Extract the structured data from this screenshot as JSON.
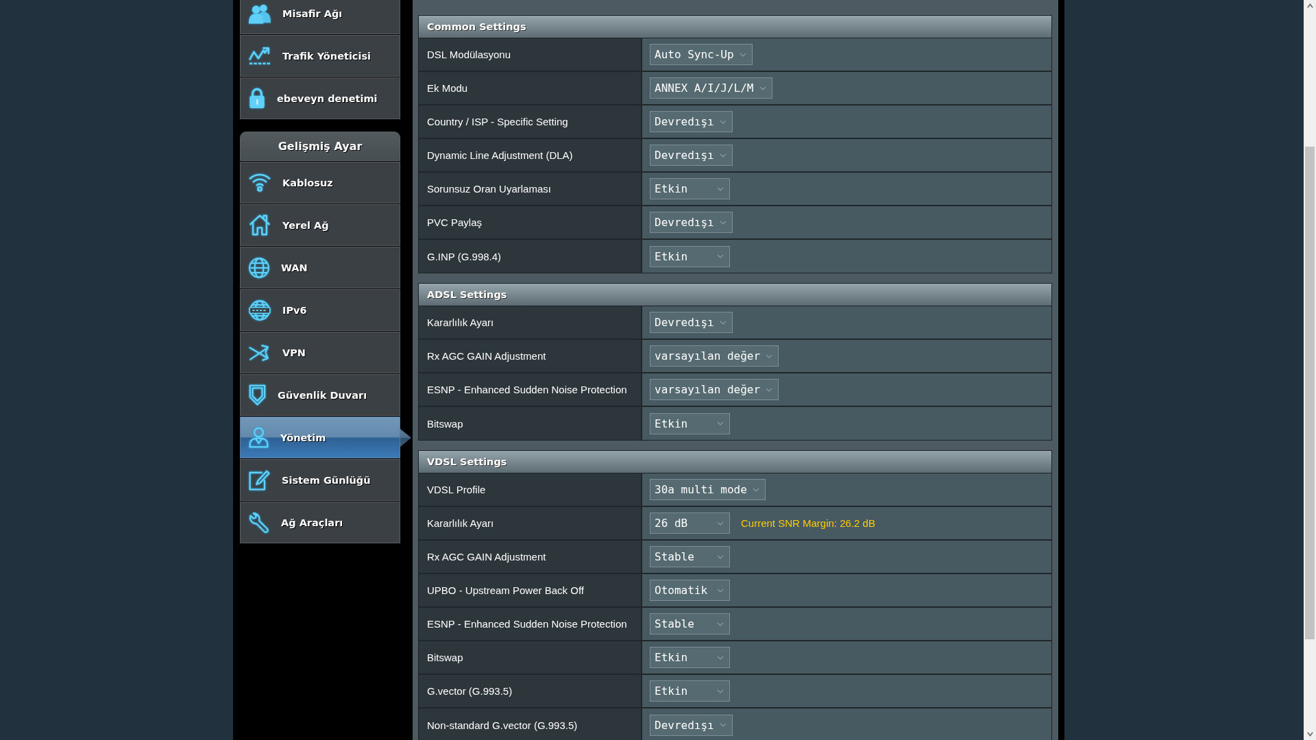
{
  "sidebar": {
    "general_items": [
      {
        "label": "Misafir Ağı",
        "selected": false
      },
      {
        "label": "Trafik Yöneticisi",
        "selected": false
      },
      {
        "label": "ebeveyn denetimi",
        "selected": false
      }
    ],
    "advanced_section": {
      "title": "Gelişmiş Ayar",
      "items": [
        {
          "label": "Kablosuz",
          "selected": false
        },
        {
          "label": "Yerel Ağ",
          "selected": false
        },
        {
          "label": "WAN",
          "selected": false
        },
        {
          "label": "IPv6",
          "selected": false
        },
        {
          "label": "VPN",
          "selected": false
        },
        {
          "label": "Güvenlik Duvarı",
          "selected": false
        },
        {
          "label": "Yönetim",
          "selected": true
        },
        {
          "label": "Sistem Günlüğü",
          "selected": false
        },
        {
          "label": "Ağ Araçları",
          "selected": false
        }
      ]
    }
  },
  "sections": [
    {
      "title": "Common Settings",
      "rows": [
        {
          "label": "DSL Modülasyonu",
          "value": "Auto Sync-Up"
        },
        {
          "label": "Ek Modu",
          "value": "ANNEX A/I/J/L/M"
        },
        {
          "label": "Country / ISP - Specific Setting",
          "value": "Devredışı"
        },
        {
          "label": "Dynamic Line Adjustment (DLA)",
          "value": "Devredışı"
        },
        {
          "label": "Sorunsuz Oran Uyarlaması",
          "value": "Etkin"
        },
        {
          "label": "PVC Paylaş",
          "value": "Devredışı"
        },
        {
          "label": "G.INP (G.998.4)",
          "value": "Etkin"
        }
      ]
    },
    {
      "title": "ADSL Settings",
      "rows": [
        {
          "label": "Kararlılık Ayarı",
          "value": "Devredışı"
        },
        {
          "label": "Rx AGC GAIN Adjustment",
          "value": "varsayılan değer"
        },
        {
          "label": "ESNP - Enhanced Sudden Noise Protection",
          "value": "varsayılan değer"
        },
        {
          "label": "Bitswap",
          "value": "Etkin"
        }
      ]
    },
    {
      "title": "VDSL Settings",
      "rows": [
        {
          "label": "VDSL Profile",
          "value": "30a multi mode"
        },
        {
          "label": "Kararlılık Ayarı",
          "value": "26 dB",
          "note": "Current SNR Margin: 26.2 dB"
        },
        {
          "label": "Rx AGC GAIN Adjustment",
          "value": "Stable"
        },
        {
          "label": "UPBO - Upstream Power Back Off",
          "value": "Otomatik"
        },
        {
          "label": "ESNP - Enhanced Sudden Noise Protection",
          "value": "Stable"
        },
        {
          "label": "Bitswap",
          "value": "Etkin"
        },
        {
          "label": "G.vector (G.993.5)",
          "value": "Etkin"
        },
        {
          "label": "Non-standard G.vector (G.993.5)",
          "value": "Devredışı"
        }
      ]
    }
  ]
}
